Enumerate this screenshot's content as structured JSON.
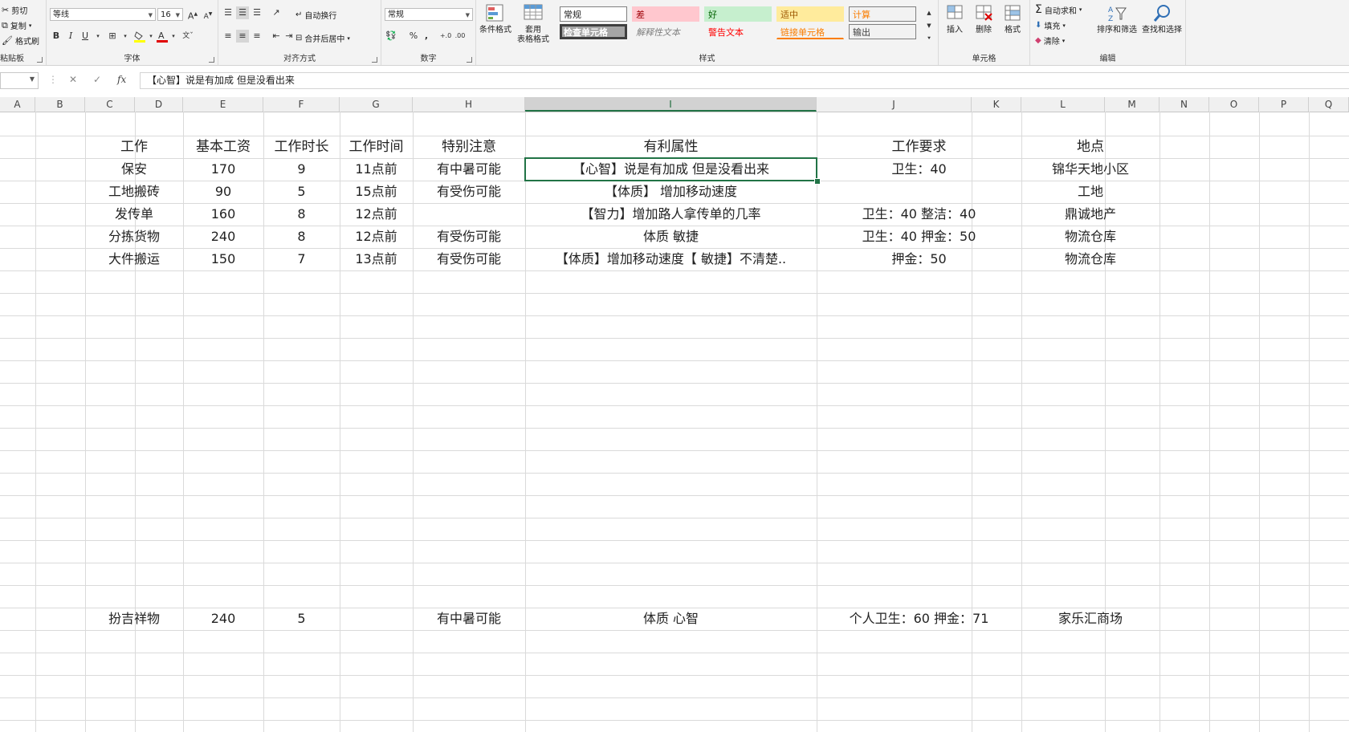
{
  "ribbon": {
    "clipboard": {
      "cut": "剪切",
      "copy": "复制",
      "format_painter": "格式刷",
      "group_label": "粘贴板"
    },
    "font": {
      "font_name": "等线",
      "font_size": "16",
      "bold": "B",
      "italic": "I",
      "underline": "U",
      "group_label": "字体"
    },
    "alignment": {
      "wrap_text": "自动换行",
      "merge_center": "合并后居中",
      "group_label": "对齐方式"
    },
    "number": {
      "format": "常规",
      "percent": "%",
      "comma": ",",
      "group_label": "数字"
    },
    "styles": {
      "conditional": "条件格式",
      "table_line1": "套用",
      "table_line2": "表格格式",
      "cells": [
        {
          "label": "常规",
          "bg": "#ffffff",
          "fg": "#222222"
        },
        {
          "label": "差",
          "bg": "#ffc7ce",
          "fg": "#9c0006"
        },
        {
          "label": "好",
          "bg": "#c6efce",
          "fg": "#006100"
        },
        {
          "label": "适中",
          "bg": "#ffeb9c",
          "fg": "#9c5700"
        },
        {
          "label": "计算",
          "bg": "#f2f2f2",
          "fg": "#fa7d00"
        },
        {
          "label": "检查单元格",
          "bg": "#a5a5a5",
          "fg": "#ffffff"
        },
        {
          "label": "解释性文本",
          "bg": "#f3f3f3",
          "fg": "#7f7f7f"
        },
        {
          "label": "警告文本",
          "bg": "#f3f3f3",
          "fg": "#ff0000"
        },
        {
          "label": "链接单元格",
          "bg": "#f3f3f3",
          "fg": "#fa7d00"
        },
        {
          "label": "输出",
          "bg": "#f2f2f2",
          "fg": "#3f3f3f"
        }
      ],
      "group_label": "样式"
    },
    "cells_group": {
      "insert": "插入",
      "delete": "删除",
      "format": "格式",
      "group_label": "单元格"
    },
    "editing": {
      "autosum": "自动求和",
      "fill": "填充",
      "clear": "清除",
      "sort_filter": "排序和筛选",
      "find_select": "查找和选择",
      "group_label": "编辑"
    }
  },
  "formula_bar": {
    "content": "【心智】说是有加成 但是没看出来"
  },
  "columns": [
    "A",
    "B",
    "C",
    "D",
    "E",
    "F",
    "G",
    "H",
    "I",
    "J",
    "K",
    "L",
    "M",
    "N",
    "O",
    "P",
    "Q"
  ],
  "selected_column": "I",
  "table": {
    "headers": [
      "工作",
      "基本工资",
      "工作时长",
      "工作时间",
      "特别注意",
      "有利属性",
      "工作要求",
      "地点"
    ],
    "rows": [
      [
        "保安",
        "170",
        "9",
        "11点前",
        "有中暑可能",
        "【心智】说是有加成 但是没看出来",
        "卫生：40",
        "锦华天地小区"
      ],
      [
        "工地搬砖",
        "90",
        "5",
        "15点前",
        "有受伤可能",
        "【体质】 增加移动速度",
        "",
        "工地"
      ],
      [
        "发传单",
        "160",
        "8",
        "12点前",
        "",
        "【智力】增加路人拿传单的几率",
        "卫生：40  整洁：40",
        "鼎诚地产"
      ],
      [
        "分拣货物",
        "240",
        "8",
        "12点前",
        "有受伤可能",
        "体质 敏捷",
        "卫生：40 押金：50",
        "物流仓库"
      ],
      [
        "大件搬运",
        "150",
        "7",
        "13点前",
        "有受伤可能",
        "【体质】增加移动速度【 敏捷】不清楚..",
        "押金：50",
        "物流仓库"
      ]
    ],
    "extra_row": [
      "扮吉祥物",
      "240",
      "5",
      "",
      "有中暑可能",
      "体质  心智",
      "个人卫生：60 押金：71",
      "家乐汇商场"
    ]
  },
  "colors": {
    "accent": "#217346",
    "grid": "#dadada",
    "ribbon_bg": "#f3f3f3"
  }
}
